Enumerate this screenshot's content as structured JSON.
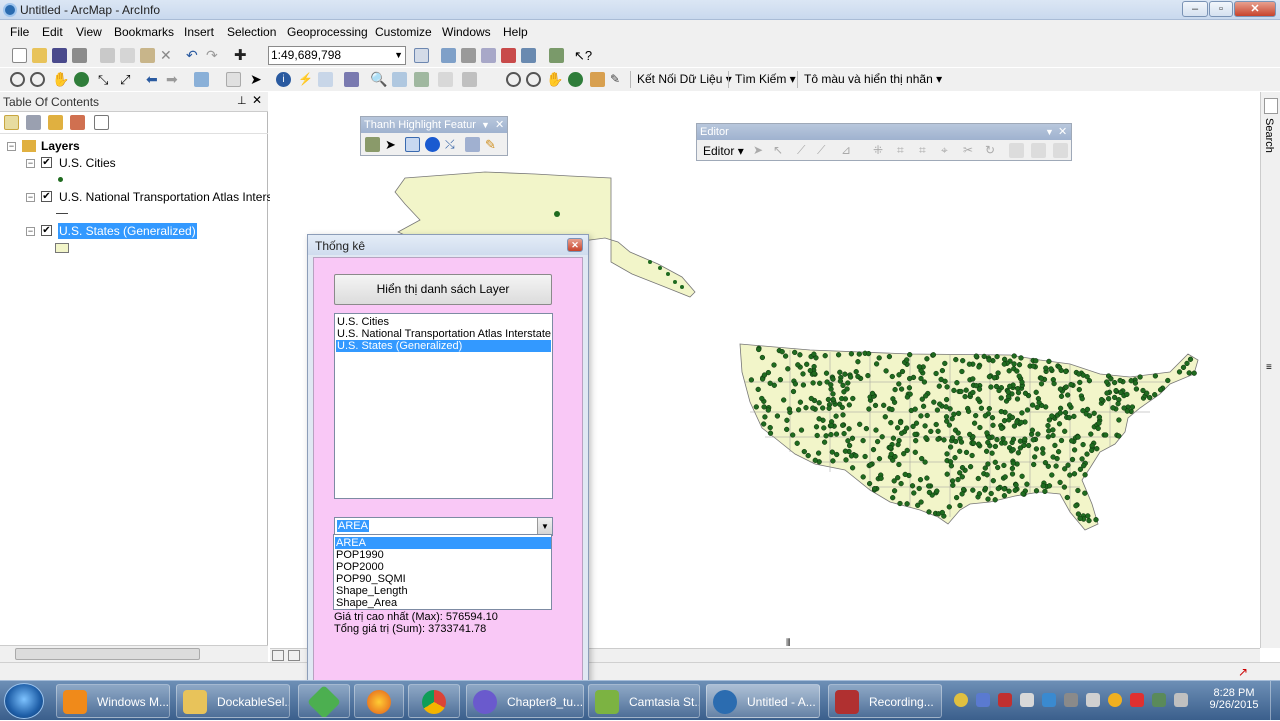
{
  "window": {
    "title": "Untitled - ArcMap - ArcInfo"
  },
  "menu": [
    "File",
    "Edit",
    "View",
    "Bookmarks",
    "Insert",
    "Selection",
    "Geoprocessing",
    "Customize",
    "Windows",
    "Help"
  ],
  "toolbar": {
    "scale": "1:49,689,798",
    "connect_label": "Kết Nối Dữ Liệu",
    "search_label": "Tìm Kiếm",
    "label_tool": "Tô màu và hiển thị nhãn"
  },
  "toc": {
    "title": "Table Of Contents",
    "root": "Layers",
    "layers": [
      "U.S. Cities",
      "U.S. National Transportation Atlas Intersta",
      "U.S. States (Generalized)"
    ]
  },
  "highlight_toolbar": {
    "title": "Thanh Highlight Featur"
  },
  "editor_toolbar": {
    "title": "Editor",
    "menu_label": "Editor"
  },
  "search_sidebar": {
    "label": "Search"
  },
  "dialog": {
    "title": "Thống kê",
    "show_layers_button": "Hiển thị danh sách Layer",
    "layer_list": [
      "U.S. Cities",
      "U.S. National Transportation Atlas Interstate Hig",
      "U.S. States (Generalized)"
    ],
    "field_selected": "AREA",
    "field_options": [
      "AREA",
      "POP1990",
      "POP2000",
      "POP90_SQMI",
      "Shape_Length",
      "Shape_Area"
    ],
    "stat_max": "Giá trị cao nhất (Max): 576594.10",
    "stat_sum": "Tổng giá trị (Sum): 3733741.78"
  },
  "taskbar": {
    "items": [
      "Windows M...",
      "DockableSel...",
      "",
      "",
      "",
      "Chapter8_tu...",
      "Camtasia St...",
      "Untitled - A...",
      "Recording..."
    ],
    "time": "8:28 PM",
    "date": "9/26/2015"
  },
  "colors": {
    "land": "#f2f5c9",
    "point": "#1f6b1f",
    "selection": "#3399ff",
    "dialog_bg": "#f9c8f6"
  }
}
